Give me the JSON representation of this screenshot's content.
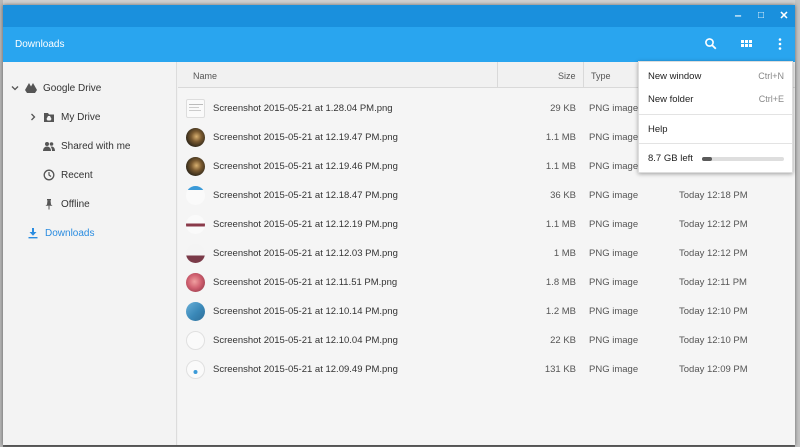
{
  "header": {
    "title": "Downloads"
  },
  "window_controls": {
    "minimize": "‒",
    "maximize": "□",
    "close": "✕"
  },
  "sidebar": {
    "items": [
      {
        "label": "Google Drive",
        "icon": "drive-icon"
      },
      {
        "label": "My Drive",
        "icon": "my-drive-icon"
      },
      {
        "label": "Shared with me",
        "icon": "shared-icon"
      },
      {
        "label": "Recent",
        "icon": "clock-icon"
      },
      {
        "label": "Offline",
        "icon": "pin-icon"
      },
      {
        "label": "Downloads",
        "icon": "download-icon"
      }
    ]
  },
  "columns": {
    "name": "Name",
    "size": "Size",
    "type": "Type"
  },
  "files": [
    {
      "name": "Screenshot 2015-05-21 at 1.28.04 PM.png",
      "size": "29 KB",
      "type": "PNG image",
      "date": ""
    },
    {
      "name": "Screenshot 2015-05-21 at 12.19.47 PM.png",
      "size": "1.1 MB",
      "type": "PNG image",
      "date": ""
    },
    {
      "name": "Screenshot 2015-05-21 at 12.19.46 PM.png",
      "size": "1.1 MB",
      "type": "PNG image",
      "date": ""
    },
    {
      "name": "Screenshot 2015-05-21 at 12.18.47 PM.png",
      "size": "36 KB",
      "type": "PNG image",
      "date": "Today 12:18 PM"
    },
    {
      "name": "Screenshot 2015-05-21 at 12.12.19 PM.png",
      "size": "1.1 MB",
      "type": "PNG image",
      "date": "Today 12:12 PM"
    },
    {
      "name": "Screenshot 2015-05-21 at 12.12.03 PM.png",
      "size": "1 MB",
      "type": "PNG image",
      "date": "Today 12:12 PM"
    },
    {
      "name": "Screenshot 2015-05-21 at 12.11.51 PM.png",
      "size": "1.8 MB",
      "type": "PNG image",
      "date": "Today 12:11 PM"
    },
    {
      "name": "Screenshot 2015-05-21 at 12.10.14 PM.png",
      "size": "1.2 MB",
      "type": "PNG image",
      "date": "Today 12:10 PM"
    },
    {
      "name": "Screenshot 2015-05-21 at 12.10.04 PM.png",
      "size": "22 KB",
      "type": "PNG image",
      "date": "Today 12:10 PM"
    },
    {
      "name": "Screenshot 2015-05-21 at 12.09.49 PM.png",
      "size": "131 KB",
      "type": "PNG image",
      "date": "Today 12:09 PM"
    }
  ],
  "menu": {
    "new_window": {
      "label": "New window",
      "shortcut": "Ctrl+N"
    },
    "new_folder": {
      "label": "New folder",
      "shortcut": "Ctrl+E"
    },
    "help": {
      "label": "Help"
    },
    "quota": {
      "label": "8.7 GB left",
      "used_fraction": 0.12
    }
  },
  "colors": {
    "titlebar": "#1a90dd",
    "header": "#29a5ef",
    "accent": "#2a8ce0"
  }
}
